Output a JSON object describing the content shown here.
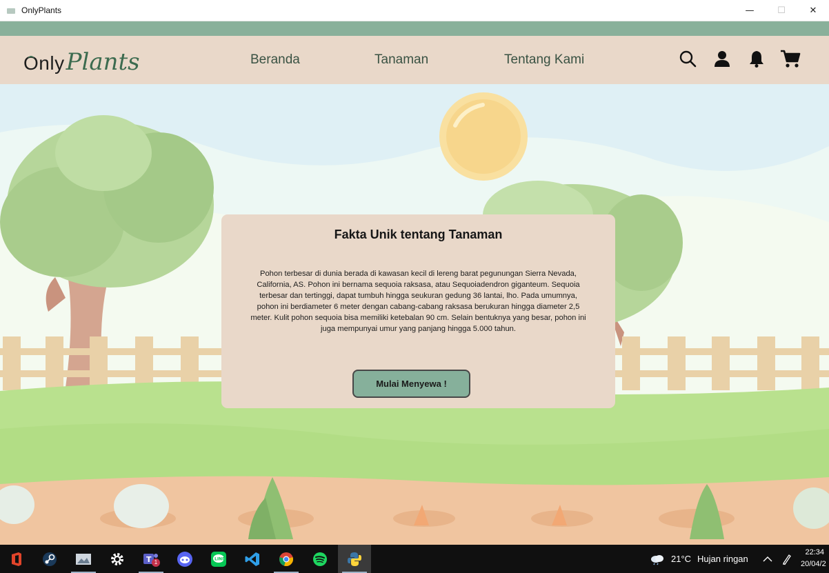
{
  "window": {
    "title": "OnlyPlants",
    "controls": [
      "minimize",
      "maximize",
      "close"
    ]
  },
  "header": {
    "logo_part1": "Only",
    "logo_part2": "Plants",
    "nav": [
      {
        "label": "Beranda"
      },
      {
        "label": "Tanaman"
      },
      {
        "label": "Tentang Kami"
      }
    ],
    "icons": [
      "search-icon",
      "user-icon",
      "bell-icon",
      "cart-icon"
    ]
  },
  "card": {
    "title": "Fakta Unik tentang Tanaman",
    "body": "Pohon terbesar di dunia berada di kawasan kecil di lereng barat pegunungan Sierra Nevada, California, AS. Pohon ini bernama sequoia raksasa, atau Sequoiadendron giganteum. Sequoia terbesar dan tertinggi, dapat tumbuh hingga seukuran gedung 36 lantai, lho. Pada umumnya, pohon ini berdiameter 6 meter dengan cabang-cabang raksasa berukuran hingga diameter 2,5 meter. Kulit pohon sequoia bisa memiliki ketebalan 90 cm. Selain bentuknya yang besar, pohon ini juga mempunyai umur yang panjang hingga 5.000 tahun.",
    "button": "Mulai Menyewa !"
  },
  "taskbar": {
    "apps": [
      "office-icon",
      "steam-icon",
      "photos-icon",
      "settings-icon",
      "teams-icon",
      "discord-icon",
      "line-icon",
      "vscode-icon",
      "chrome-icon",
      "spotify-icon",
      "python-icon"
    ],
    "teams_badge": "1",
    "weather_temp": "21°C",
    "weather_desc": "Hujan ringan",
    "time": "22:34",
    "date": "20/04/2"
  },
  "colors": {
    "header_bg": "#e9d8c9",
    "accent_green": "#89b09a",
    "logo_green": "#3c6b4f",
    "button_bg": "#86b09b"
  }
}
